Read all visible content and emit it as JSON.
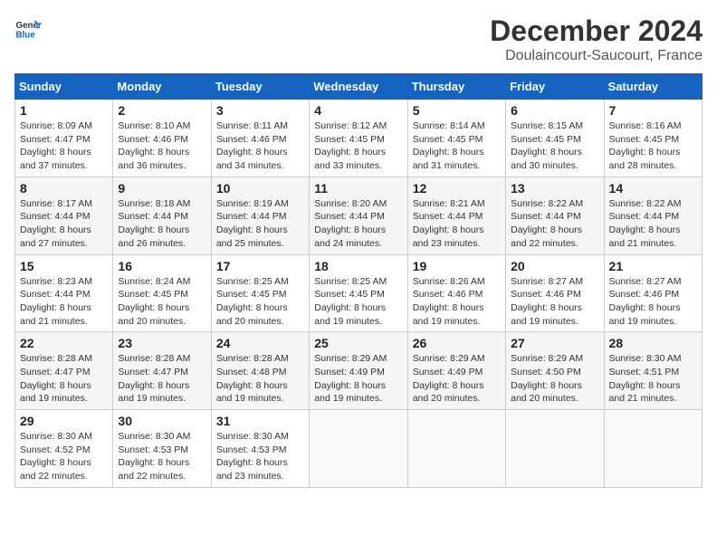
{
  "header": {
    "logo_general": "General",
    "logo_blue": "Blue",
    "month_title": "December 2024",
    "location": "Doulaincourt-Saucourt, France"
  },
  "weekdays": [
    "Sunday",
    "Monday",
    "Tuesday",
    "Wednesday",
    "Thursday",
    "Friday",
    "Saturday"
  ],
  "weeks": [
    [
      {
        "day": "1",
        "sunrise": "8:09 AM",
        "sunset": "4:47 PM",
        "daylight": "8 hours and 37 minutes."
      },
      {
        "day": "2",
        "sunrise": "8:10 AM",
        "sunset": "4:46 PM",
        "daylight": "8 hours and 36 minutes."
      },
      {
        "day": "3",
        "sunrise": "8:11 AM",
        "sunset": "4:46 PM",
        "daylight": "8 hours and 34 minutes."
      },
      {
        "day": "4",
        "sunrise": "8:12 AM",
        "sunset": "4:45 PM",
        "daylight": "8 hours and 33 minutes."
      },
      {
        "day": "5",
        "sunrise": "8:14 AM",
        "sunset": "4:45 PM",
        "daylight": "8 hours and 31 minutes."
      },
      {
        "day": "6",
        "sunrise": "8:15 AM",
        "sunset": "4:45 PM",
        "daylight": "8 hours and 30 minutes."
      },
      {
        "day": "7",
        "sunrise": "8:16 AM",
        "sunset": "4:45 PM",
        "daylight": "8 hours and 28 minutes."
      }
    ],
    [
      {
        "day": "8",
        "sunrise": "8:17 AM",
        "sunset": "4:44 PM",
        "daylight": "8 hours and 27 minutes."
      },
      {
        "day": "9",
        "sunrise": "8:18 AM",
        "sunset": "4:44 PM",
        "daylight": "8 hours and 26 minutes."
      },
      {
        "day": "10",
        "sunrise": "8:19 AM",
        "sunset": "4:44 PM",
        "daylight": "8 hours and 25 minutes."
      },
      {
        "day": "11",
        "sunrise": "8:20 AM",
        "sunset": "4:44 PM",
        "daylight": "8 hours and 24 minutes."
      },
      {
        "day": "12",
        "sunrise": "8:21 AM",
        "sunset": "4:44 PM",
        "daylight": "8 hours and 23 minutes."
      },
      {
        "day": "13",
        "sunrise": "8:22 AM",
        "sunset": "4:44 PM",
        "daylight": "8 hours and 22 minutes."
      },
      {
        "day": "14",
        "sunrise": "8:22 AM",
        "sunset": "4:44 PM",
        "daylight": "8 hours and 21 minutes."
      }
    ],
    [
      {
        "day": "15",
        "sunrise": "8:23 AM",
        "sunset": "4:44 PM",
        "daylight": "8 hours and 21 minutes."
      },
      {
        "day": "16",
        "sunrise": "8:24 AM",
        "sunset": "4:45 PM",
        "daylight": "8 hours and 20 minutes."
      },
      {
        "day": "17",
        "sunrise": "8:25 AM",
        "sunset": "4:45 PM",
        "daylight": "8 hours and 20 minutes."
      },
      {
        "day": "18",
        "sunrise": "8:25 AM",
        "sunset": "4:45 PM",
        "daylight": "8 hours and 19 minutes."
      },
      {
        "day": "19",
        "sunrise": "8:26 AM",
        "sunset": "4:46 PM",
        "daylight": "8 hours and 19 minutes."
      },
      {
        "day": "20",
        "sunrise": "8:27 AM",
        "sunset": "4:46 PM",
        "daylight": "8 hours and 19 minutes."
      },
      {
        "day": "21",
        "sunrise": "8:27 AM",
        "sunset": "4:46 PM",
        "daylight": "8 hours and 19 minutes."
      }
    ],
    [
      {
        "day": "22",
        "sunrise": "8:28 AM",
        "sunset": "4:47 PM",
        "daylight": "8 hours and 19 minutes."
      },
      {
        "day": "23",
        "sunrise": "8:28 AM",
        "sunset": "4:47 PM",
        "daylight": "8 hours and 19 minutes."
      },
      {
        "day": "24",
        "sunrise": "8:28 AM",
        "sunset": "4:48 PM",
        "daylight": "8 hours and 19 minutes."
      },
      {
        "day": "25",
        "sunrise": "8:29 AM",
        "sunset": "4:49 PM",
        "daylight": "8 hours and 19 minutes."
      },
      {
        "day": "26",
        "sunrise": "8:29 AM",
        "sunset": "4:49 PM",
        "daylight": "8 hours and 20 minutes."
      },
      {
        "day": "27",
        "sunrise": "8:29 AM",
        "sunset": "4:50 PM",
        "daylight": "8 hours and 20 minutes."
      },
      {
        "day": "28",
        "sunrise": "8:30 AM",
        "sunset": "4:51 PM",
        "daylight": "8 hours and 21 minutes."
      }
    ],
    [
      {
        "day": "29",
        "sunrise": "8:30 AM",
        "sunset": "4:52 PM",
        "daylight": "8 hours and 22 minutes."
      },
      {
        "day": "30",
        "sunrise": "8:30 AM",
        "sunset": "4:53 PM",
        "daylight": "8 hours and 22 minutes."
      },
      {
        "day": "31",
        "sunrise": "8:30 AM",
        "sunset": "4:53 PM",
        "daylight": "8 hours and 23 minutes."
      },
      null,
      null,
      null,
      null
    ]
  ],
  "labels": {
    "sunrise": "Sunrise:",
    "sunset": "Sunset:",
    "daylight": "Daylight:"
  }
}
